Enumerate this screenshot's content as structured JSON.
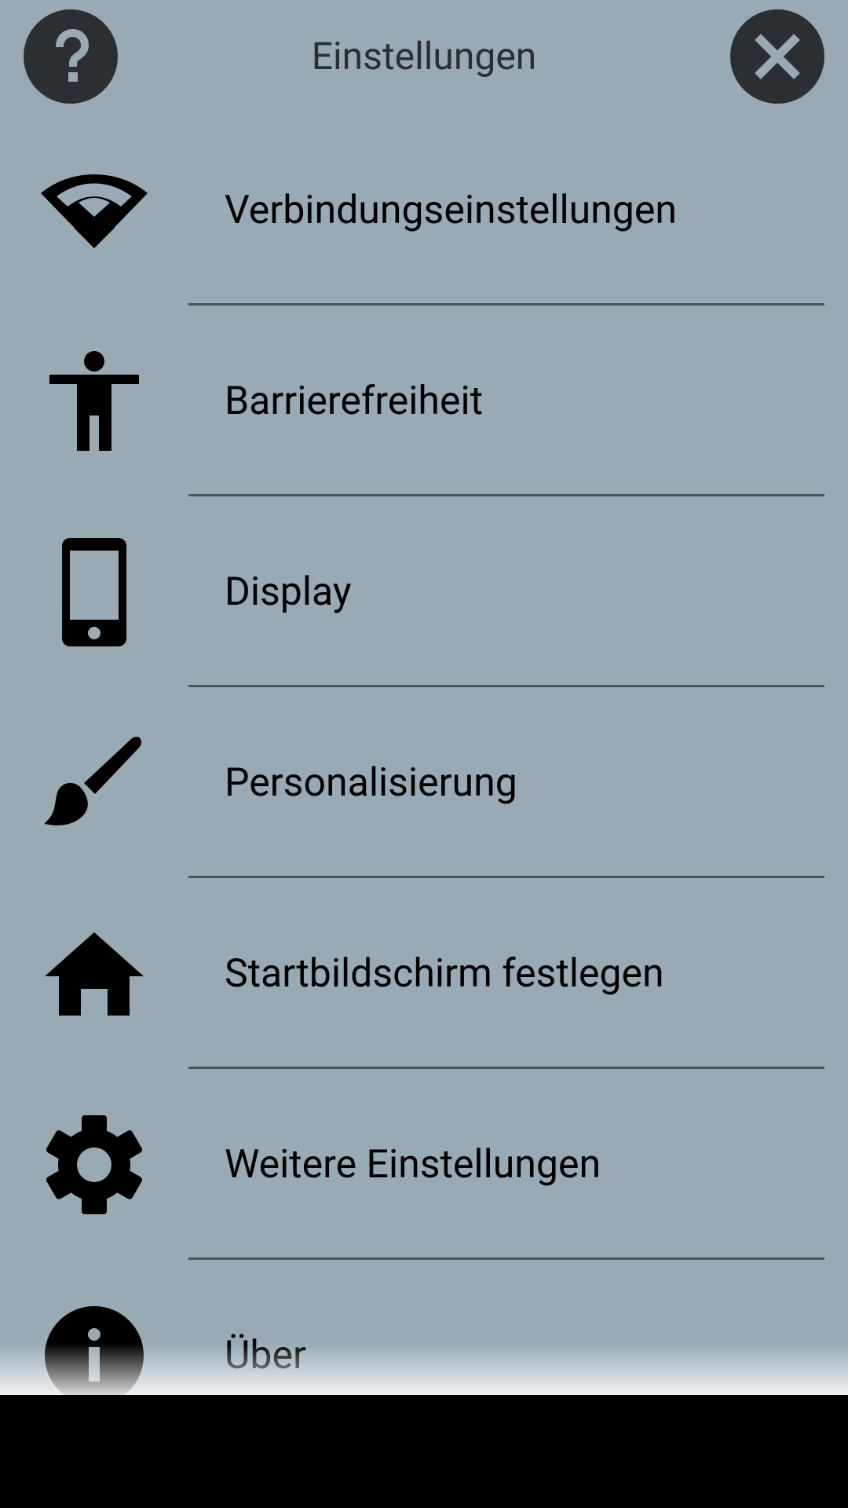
{
  "header": {
    "title": "Einstellungen",
    "help_icon": "help-icon",
    "close_icon": "close-icon"
  },
  "colors": {
    "background": "#99aab5",
    "button_bg": "#2b2f33",
    "button_glyph": "#99aab5",
    "divider": "#4a5358",
    "text": "#000000"
  },
  "menu": {
    "items": [
      {
        "label": "Verbindungseinstellungen",
        "icon": "wifi-icon"
      },
      {
        "label": "Barrierefreiheit",
        "icon": "accessibility-icon"
      },
      {
        "label": "Display",
        "icon": "smartphone-icon"
      },
      {
        "label": "Personalisierung",
        "icon": "brush-icon"
      },
      {
        "label": "Startbildschirm festlegen",
        "icon": "home-icon"
      },
      {
        "label": "Weitere Einstellungen",
        "icon": "gear-icon"
      },
      {
        "label": "Über",
        "icon": "info-icon"
      }
    ]
  }
}
